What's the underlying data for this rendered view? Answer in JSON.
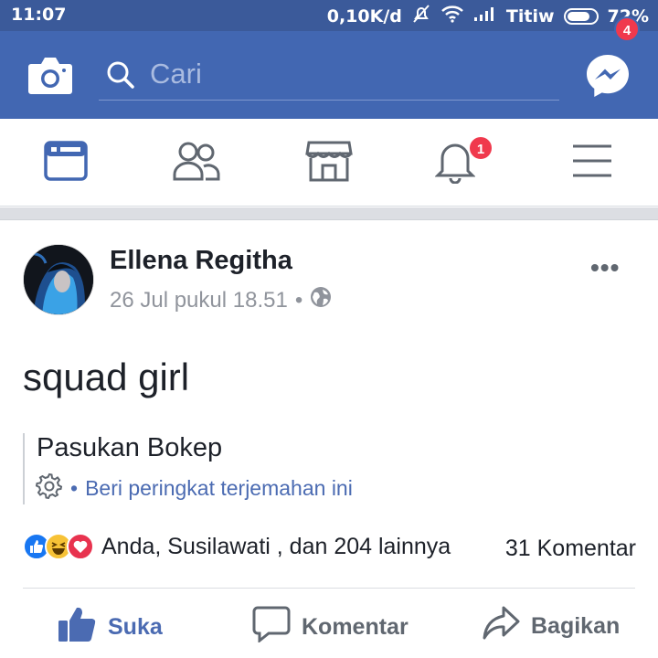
{
  "status_bar": {
    "time": "11:07",
    "speed": "0,10K/d",
    "carrier": "Titiw",
    "battery": "72%"
  },
  "header": {
    "search_placeholder": "Cari",
    "messenger_badge": "4",
    "brand_color": "#4267b2"
  },
  "nav": {
    "tabs": [
      {
        "name": "news-feed",
        "icon": "news-feed-icon",
        "active": true
      },
      {
        "name": "friends",
        "icon": "friends-icon"
      },
      {
        "name": "marketplace",
        "icon": "marketplace-icon"
      },
      {
        "name": "notifications",
        "icon": "bell-icon"
      },
      {
        "name": "menu",
        "icon": "hamburger-menu-icon"
      }
    ],
    "notification_badge": "1"
  },
  "post": {
    "author": "Ellena Regitha",
    "timestamp": "26 Jul pukul 18.51",
    "privacy_icon": "globe-icon",
    "text": "squad girl",
    "translation": "Pasukan Bokep",
    "rate_translation": "Beri peringkat terjemahan ini",
    "reactions_text": "Anda, Susilawati , dan 204 lainnya",
    "reaction_icons": [
      "like-reaction-icon",
      "haha-reaction-icon",
      "love-reaction-icon"
    ],
    "comments": "31 Komentar"
  },
  "actions": {
    "like": "Suka",
    "comment": "Komentar",
    "share": "Bagikan"
  }
}
